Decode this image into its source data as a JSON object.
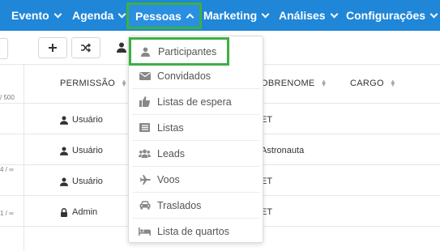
{
  "nav": {
    "items": [
      {
        "label": "Evento"
      },
      {
        "label": "Agenda"
      },
      {
        "label": "Pessoas"
      },
      {
        "label": "Marketing"
      },
      {
        "label": "Análises"
      },
      {
        "label": "Configurações"
      }
    ]
  },
  "left_col": {
    "texts": [
      "/ 500",
      "4 / ∞",
      "1 / ∞"
    ]
  },
  "table": {
    "headers": {
      "permissao": "PERMISSÃO",
      "sobrenome": "OBRENOME",
      "cargo": "CARGO"
    },
    "rows": [
      {
        "perm": "Usuário",
        "sobrenome": "ET"
      },
      {
        "perm": "Usuário",
        "sobrenome": "Astronauta"
      },
      {
        "perm": "Usuário",
        "sobrenome": "ET"
      },
      {
        "perm": "Admin",
        "sobrenome": "ET"
      }
    ]
  },
  "dropdown": {
    "items": [
      {
        "label": "Participantes",
        "icon": "user-icon"
      },
      {
        "label": "Convidados",
        "icon": "envelope-icon"
      },
      {
        "label": "Listas de espera",
        "icon": "thumbs-up-icon"
      },
      {
        "label": "Listas",
        "icon": "list-icon"
      },
      {
        "label": "Leads",
        "icon": "users-icon"
      },
      {
        "label": "Voos",
        "icon": "plane-icon"
      },
      {
        "label": "Traslados",
        "icon": "car-icon"
      },
      {
        "label": "Lista de quartos",
        "icon": "bed-icon"
      }
    ]
  },
  "colors": {
    "nav_bg": "#1f86d8",
    "highlight": "#3cb043"
  }
}
